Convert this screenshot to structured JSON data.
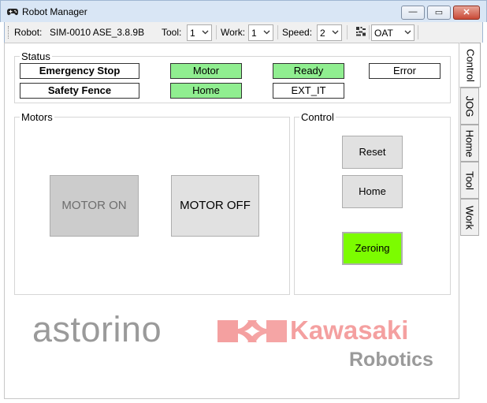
{
  "window": {
    "title": "Robot Manager",
    "minimize_glyph": "—",
    "maximize_glyph": "▭",
    "close_glyph": "✕"
  },
  "toolbar": {
    "robot_label": "Robot:",
    "robot_value": "SIM-0010 ASE_3.8.9B",
    "tool_label": "Tool:",
    "tool_value": "1",
    "work_label": "Work:",
    "work_value": "1",
    "speed_label": "Speed:",
    "speed_value": "2",
    "icon": "grid-icon",
    "mode_value": "OAT"
  },
  "status": {
    "title": "Status",
    "emergency_stop": "Emergency Stop",
    "motor": "Motor",
    "ready": "Ready",
    "error": "Error",
    "safety_fence": "Safety Fence",
    "home": "Home",
    "ext_it": "EXT_IT",
    "active_color": "#90ee90"
  },
  "motors": {
    "title": "Motors",
    "motor_on": "MOTOR ON",
    "motor_off": "MOTOR OFF"
  },
  "control": {
    "title": "Control",
    "reset": "Reset",
    "home": "Home",
    "zeroing": "Zeroing",
    "zeroing_color": "#7cfc00"
  },
  "branding": {
    "astorino": "astorino",
    "kawasaki": "Kawasaki",
    "robotics": "Robotics",
    "astorino_color": "#9a9a9a",
    "kawasaki_color": "#f4a0a0"
  },
  "tabs": [
    "Control",
    "JOG",
    "Home",
    "Tool",
    "Work"
  ]
}
